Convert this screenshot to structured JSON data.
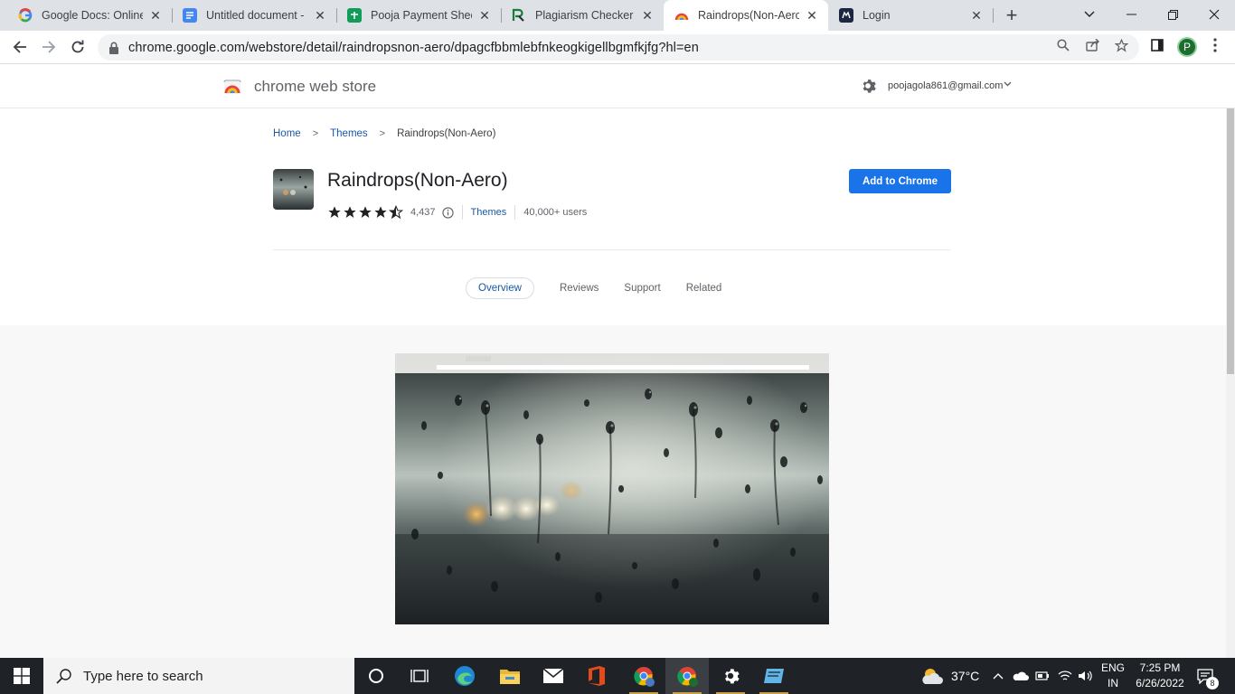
{
  "browser": {
    "tabs": [
      {
        "title": "Google Docs: Online D",
        "icon": "google-g-icon",
        "active": false
      },
      {
        "title": "Untitled document - G",
        "icon": "google-docs-icon",
        "active": false
      },
      {
        "title": "Pooja Payment Sheet",
        "icon": "google-sheets-icon",
        "active": false
      },
      {
        "title": "Plagiarism Checker - F",
        "icon": "plagiarism-checker-icon",
        "active": false
      },
      {
        "title": "Raindrops(Non-Aero)",
        "icon": "chrome-web-store-icon",
        "active": true
      },
      {
        "title": "Login",
        "icon": "login-site-icon",
        "active": false
      }
    ],
    "url": "chrome.google.com/webstore/detail/raindropsnon-aero/dpagcfbbmlebfnkeogkigellbgmfkjfg?hl=en",
    "profile_initial": "P"
  },
  "store": {
    "name": "chrome web store",
    "account": "poojagola861@gmail.com"
  },
  "breadcrumb": [
    "Home",
    "Themes",
    "Raindrops(Non-Aero)"
  ],
  "item": {
    "title": "Raindrops(Non-Aero)",
    "rating": 4.5,
    "rating_count": "4,437",
    "category": "Themes",
    "users": "40,000+ users",
    "add_button": "Add to Chrome"
  },
  "detail_tabs": [
    "Overview",
    "Reviews",
    "Support",
    "Related"
  ],
  "active_detail_tab": "Overview",
  "taskbar": {
    "search_placeholder": "Type here to search",
    "weather": "37°C",
    "lang_line1": "ENG",
    "lang_line2": "IN",
    "time": "7:25 PM",
    "date": "6/26/2022",
    "notification_count": "8"
  }
}
